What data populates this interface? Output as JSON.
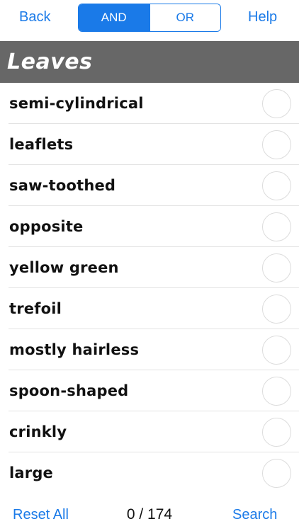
{
  "topbar": {
    "back_label": "Back",
    "help_label": "Help",
    "segments": [
      {
        "label": "AND",
        "selected": true
      },
      {
        "label": "OR",
        "selected": false
      }
    ]
  },
  "section": {
    "title": "Leaves"
  },
  "options": [
    {
      "label": "semi-cylindrical",
      "selected": false
    },
    {
      "label": "leaflets",
      "selected": false
    },
    {
      "label": "saw-toothed",
      "selected": false
    },
    {
      "label": "opposite",
      "selected": false
    },
    {
      "label": "yellow green",
      "selected": false
    },
    {
      "label": "trefoil",
      "selected": false
    },
    {
      "label": "mostly hairless",
      "selected": false
    },
    {
      "label": "spoon-shaped",
      "selected": false
    },
    {
      "label": "crinkly",
      "selected": false
    },
    {
      "label": "large",
      "selected": false
    }
  ],
  "bottombar": {
    "reset_label": "Reset All",
    "counter": "0 / 174",
    "search_label": "Search"
  },
  "colors": {
    "accent": "#1a7ae8",
    "header_bg": "#676767"
  }
}
